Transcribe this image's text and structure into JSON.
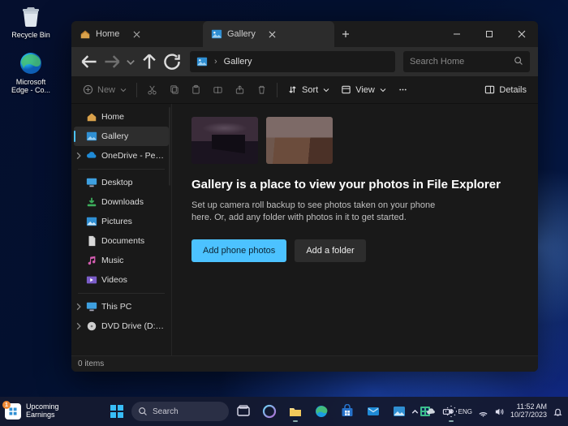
{
  "desktop": {
    "icons": [
      {
        "name": "Recycle Bin"
      },
      {
        "name": "Microsoft Edge - Co..."
      }
    ]
  },
  "window": {
    "tabs": [
      {
        "label": "Home",
        "active": false
      },
      {
        "label": "Gallery",
        "active": true
      }
    ],
    "address": {
      "crumb": "Gallery"
    },
    "search": {
      "placeholder": "Search Home"
    },
    "toolbar": {
      "new_label": "New",
      "sort_label": "Sort",
      "view_label": "View",
      "details_label": "Details"
    },
    "sidebar": {
      "items": [
        {
          "label": "Home",
          "icon": "home"
        },
        {
          "label": "Gallery",
          "icon": "gallery"
        },
        {
          "label": "OneDrive - Personal",
          "icon": "onedrive"
        },
        {
          "label": "Desktop",
          "icon": "desktop"
        },
        {
          "label": "Downloads",
          "icon": "downloads"
        },
        {
          "label": "Pictures",
          "icon": "pictures"
        },
        {
          "label": "Documents",
          "icon": "documents"
        },
        {
          "label": "Music",
          "icon": "music"
        },
        {
          "label": "Videos",
          "icon": "videos"
        },
        {
          "label": "This PC",
          "icon": "pc"
        },
        {
          "label": "DVD Drive (D:) CCC",
          "icon": "dvd"
        }
      ]
    },
    "gallery": {
      "title": "Gallery is a place to view your photos in File Explorer",
      "body": "Set up camera roll backup to see photos taken on your phone here. Or, add any folder with photos in it to get started.",
      "primary_button": "Add phone photos",
      "secondary_button": "Add a folder"
    },
    "status": {
      "items_text": "0 items"
    }
  },
  "taskbar": {
    "widget": {
      "badge": "1",
      "line1": "Upcoming",
      "line2": "Earnings"
    },
    "search_placeholder": "Search",
    "clock": {
      "time": "11:52 AM",
      "date": "10/27/2023"
    }
  },
  "colors": {
    "accent": "#4cc2ff"
  }
}
